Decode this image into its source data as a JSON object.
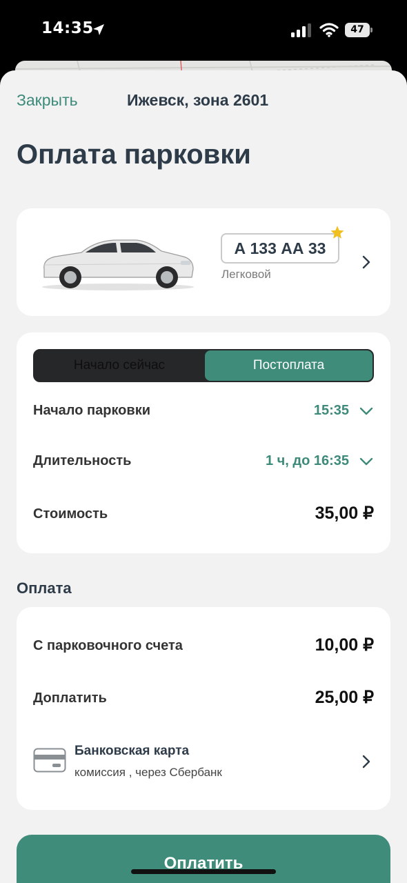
{
  "status_bar": {
    "time": "14:35",
    "battery": "47",
    "icons": [
      "location-arrow-icon",
      "cellular-signal-icon",
      "wifi-icon",
      "battery-icon"
    ]
  },
  "header": {
    "close_label": "Закрыть",
    "zone": "Ижевск, зона 2601",
    "title": "Оплата парковки"
  },
  "vehicle": {
    "plate": "А 133 АА 33",
    "type": "Легковой",
    "favorite": true
  },
  "parking": {
    "modes": [
      "Начало сейчас",
      "Постоплата"
    ],
    "selected_mode": "Постоплата",
    "start_label": "Начало парковки",
    "start_value": "15:35",
    "duration_label": "Длительность",
    "duration_value": "1 ч, до 16:35",
    "cost_label": "Стоимость",
    "cost_value": "35,00 ₽"
  },
  "payment": {
    "section_title": "Оплата",
    "account_label": "С парковочного счета",
    "account_value": "10,00 ₽",
    "topup_label": "Доплатить",
    "topup_value": "25,00 ₽",
    "method_title": "Банковская карта",
    "method_subtitle": "комиссия , через Сбербанк"
  },
  "action": {
    "pay_label": "Оплатить"
  },
  "colors": {
    "accent": "#3f8c7b",
    "text_dark": "#2e3b48",
    "background": "#f2f2f2",
    "star": "#f0c020"
  }
}
